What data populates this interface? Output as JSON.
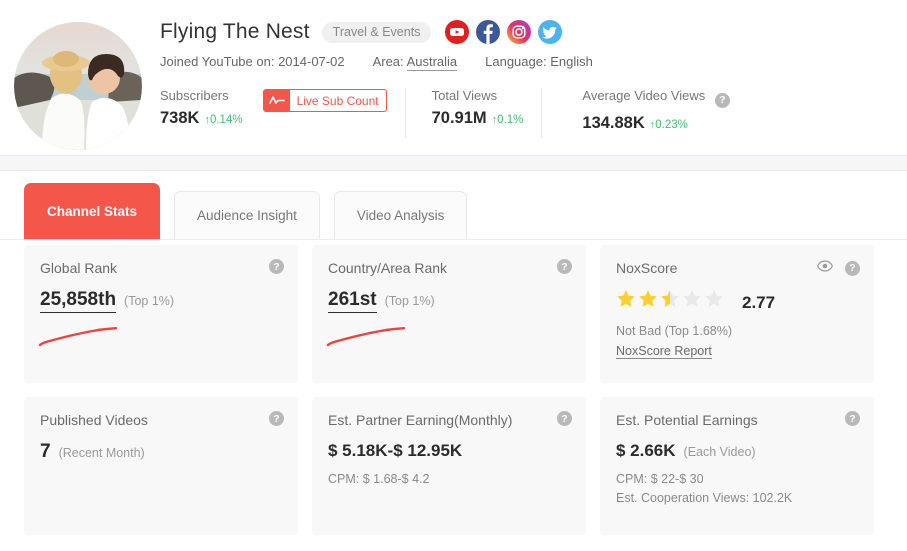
{
  "profile": {
    "name": "Flying The Nest",
    "category": "Travel & Events",
    "joined_label": "Joined YouTube on: 2014-07-02",
    "area_label": "Area:",
    "area_value": "Australia",
    "language_label": "Language: English",
    "avatar_alt": "couple-on-beach-avatar",
    "socials": [
      {
        "name": "youtube-icon",
        "color": "#E02020"
      },
      {
        "name": "facebook-icon",
        "color": "#3B5998"
      },
      {
        "name": "instagram-icon",
        "color": "#C13584"
      },
      {
        "name": "twitter-icon",
        "color": "#4BB3EF"
      }
    ]
  },
  "stats": [
    {
      "label": "Subscribers",
      "value": "738K",
      "delta": "0.14%",
      "arrow": "↑"
    },
    {
      "label": "Total Views",
      "value": "70.91M",
      "delta": "0.1%",
      "arrow": "↑"
    },
    {
      "label": "Average Video Views",
      "value": "134.88K",
      "delta": "0.23%",
      "arrow": "↑",
      "help": true
    }
  ],
  "live_button": {
    "label": "Live Sub Count",
    "icon": "pulse-icon",
    "color": "#F5564A"
  },
  "tabs": [
    {
      "label": "Channel Stats",
      "active": true
    },
    {
      "label": "Audience Insight",
      "active": false
    },
    {
      "label": "Video Analysis",
      "active": false
    }
  ],
  "cards": {
    "global_rank": {
      "title": "Global Rank",
      "value": "25,858th",
      "note": "(Top 1%)",
      "help": "?",
      "sparkline_color": "#F04040"
    },
    "country_rank": {
      "title": "Country/Area Rank",
      "value": "261st",
      "note": "(Top 1%)",
      "help": "?",
      "sparkline_color": "#F04040"
    },
    "noxscore": {
      "title": "NoxScore",
      "score": "2.77",
      "stars_filled": 2,
      "stars_half": 1,
      "stars_total": 5,
      "star_color": "#FACF32",
      "star_empty_color": "#E9E9EB",
      "description": "Not Bad (Top 1.68%)",
      "report_link": "NoxScore Report",
      "eye_icon": "eye-icon",
      "help": "?"
    },
    "published_videos": {
      "title": "Published Videos",
      "value": "7",
      "note": "(Recent Month)",
      "help": "?"
    },
    "partner_earning": {
      "title": "Est. Partner Earning(Monthly)",
      "value": "$ 5.18K-$ 12.95K",
      "cpm": "CPM: $ 1.68-$ 4.2",
      "help": "?"
    },
    "potential_earnings": {
      "title": "Est. Potential Earnings",
      "value": "$ 2.66K",
      "note": "(Each Video)",
      "cpm": "CPM: $ 22-$ 30",
      "coop_views": "Est. Cooperation Views: 102.2K",
      "help": "?"
    }
  }
}
